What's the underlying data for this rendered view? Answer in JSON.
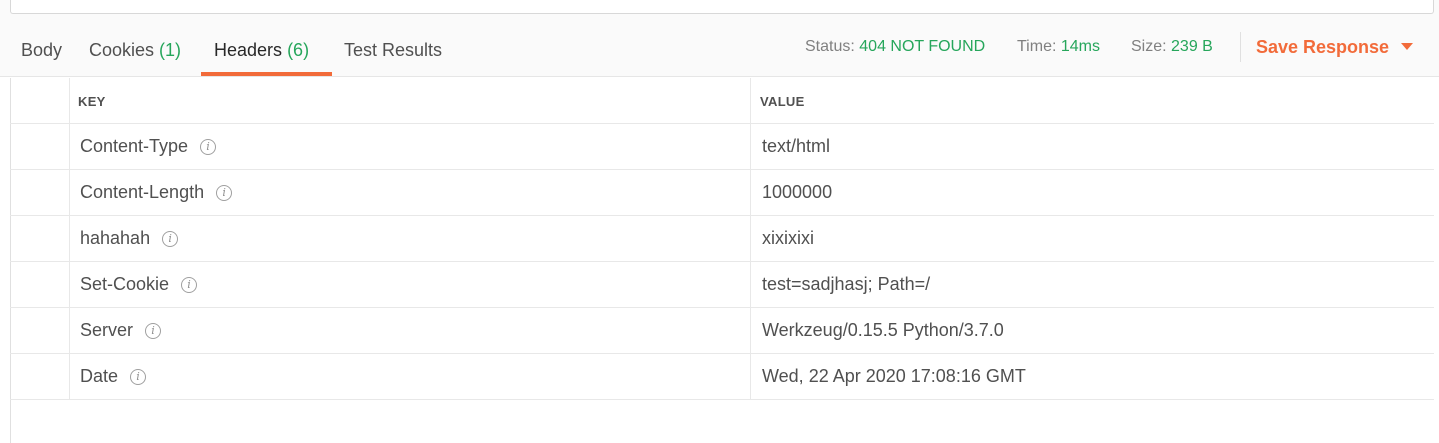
{
  "tabs": [
    {
      "label": "Body",
      "count": ""
    },
    {
      "label": "Cookies",
      "count": "(1)"
    },
    {
      "label": "Headers",
      "count": "(6)"
    },
    {
      "label": "Test Results",
      "count": ""
    }
  ],
  "active_tab": "Headers",
  "status": {
    "label": "Status:",
    "value": "404 NOT FOUND"
  },
  "time": {
    "label": "Time:",
    "value": "14ms"
  },
  "size": {
    "label": "Size:",
    "value": "239 B"
  },
  "save_response": {
    "label": "Save Response"
  },
  "table": {
    "columns": {
      "key": "KEY",
      "value": "VALUE"
    },
    "rows": [
      {
        "key": "Content-Type",
        "value": "text/html"
      },
      {
        "key": "Content-Length",
        "value": "1000000"
      },
      {
        "key": "hahahah",
        "value": "xixixixi"
      },
      {
        "key": "Set-Cookie",
        "value": "test=sadjhasj; Path=/"
      },
      {
        "key": "Server",
        "value": "Werkzeug/0.15.5 Python/3.7.0"
      },
      {
        "key": "Date",
        "value": "Wed, 22 Apr 2020 17:08:16 GMT"
      }
    ]
  },
  "colors": {
    "accent": "#f26b3a",
    "success": "#26a65b"
  },
  "icons": {
    "row_info": "info-icon",
    "save_dropdown": "caret-down-icon"
  }
}
